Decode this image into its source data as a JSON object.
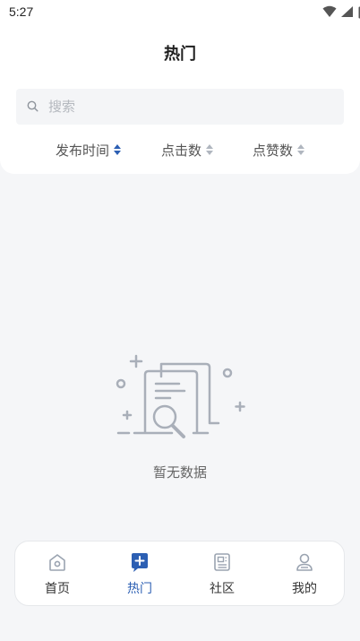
{
  "status_bar": {
    "time": "5:27"
  },
  "header": {
    "title": "热门"
  },
  "search": {
    "placeholder": "搜索",
    "value": ""
  },
  "sort": [
    {
      "label": "发布时间",
      "active": true
    },
    {
      "label": "点击数",
      "active": false
    },
    {
      "label": "点赞数",
      "active": false
    }
  ],
  "empty_state": {
    "text": "暂无数据"
  },
  "tabbar": {
    "items": [
      {
        "label": "首页",
        "icon": "home-icon",
        "active": false
      },
      {
        "label": "热门",
        "icon": "hot-icon",
        "active": true
      },
      {
        "label": "社区",
        "icon": "community-icon",
        "active": false
      },
      {
        "label": "我的",
        "icon": "profile-icon",
        "active": false
      }
    ]
  },
  "colors": {
    "accent": "#2c5fb3",
    "inactive_icon": "#9aa3b0",
    "background": "#f5f6f8"
  }
}
